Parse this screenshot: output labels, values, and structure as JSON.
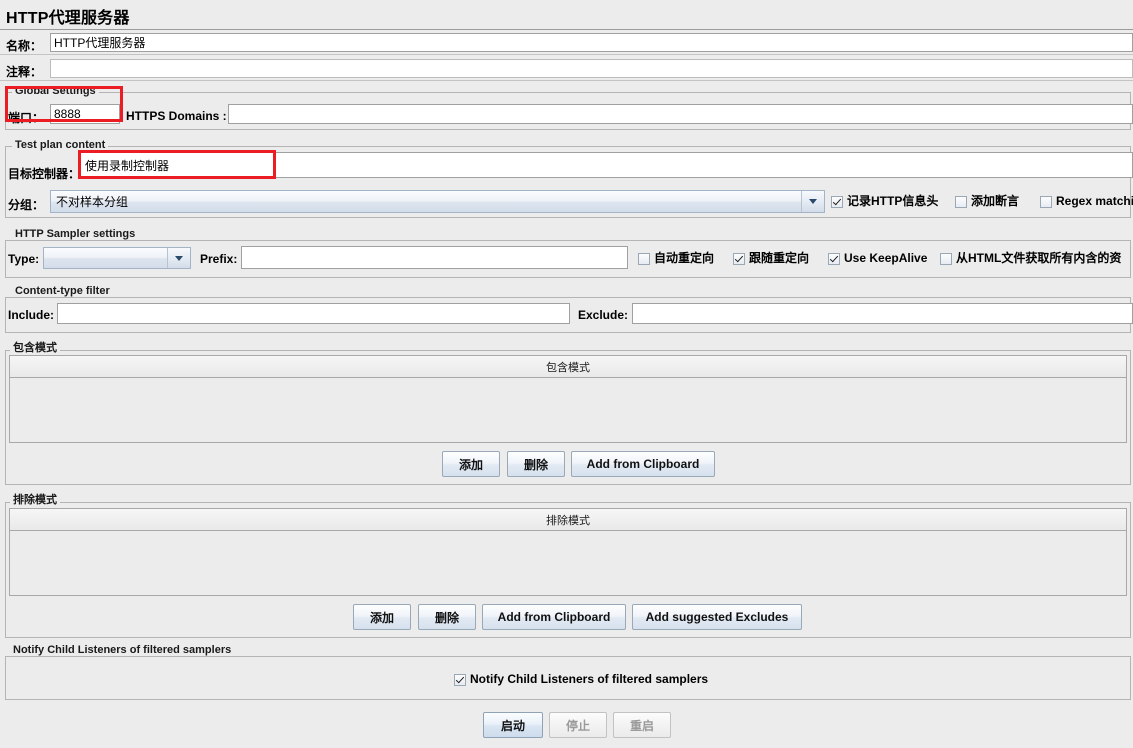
{
  "window": {
    "title": "HTTP代理服务器"
  },
  "fields": {
    "name_label": "名称：",
    "name_value": "HTTP代理服务器",
    "comment_label": "注释：",
    "comment_value": ""
  },
  "global_settings": {
    "panel_title": "Global Settings",
    "port_label": "端口：",
    "port_value": "8888",
    "https_domains_label": "HTTPS Domains :",
    "https_domains_value": ""
  },
  "test_plan_content": {
    "panel_title": "Test plan content",
    "target_controller_label": "目标控制器：",
    "target_controller_value": "使用录制控制器",
    "grouping_label": "分组：",
    "grouping_value": "不对样本分组",
    "checkboxes": [
      {
        "label": "记录HTTP信息头",
        "checked": true
      },
      {
        "label": "添加断言",
        "checked": false
      },
      {
        "label": "Regex matchin",
        "checked": false
      }
    ]
  },
  "http_sampler_settings": {
    "panel_title": "HTTP Sampler settings",
    "type_label": "Type:",
    "type_value": "",
    "prefix_label": "Prefix:",
    "prefix_value": "",
    "checkboxes": [
      {
        "label": "自动重定向",
        "checked": false
      },
      {
        "label": "跟随重定向",
        "checked": true
      },
      {
        "label": "Use KeepAlive",
        "checked": true
      },
      {
        "label": "从HTML文件获取所有内含的资",
        "checked": false
      }
    ]
  },
  "content_type_filter": {
    "panel_title": "Content-type filter",
    "include_label": "Include:",
    "include_value": "",
    "exclude_label": "Exclude:",
    "exclude_value": ""
  },
  "include_patterns": {
    "panel_title": "包含模式",
    "column_header": "包含模式",
    "rows": [],
    "buttons": [
      {
        "label": "添加",
        "name": "add-button"
      },
      {
        "label": "删除",
        "name": "delete-button"
      },
      {
        "label": "Add from Clipboard",
        "name": "add-from-clipboard-button"
      }
    ]
  },
  "exclude_patterns": {
    "panel_title": "排除模式",
    "column_header": "排除模式",
    "rows": [],
    "buttons": [
      {
        "label": "添加",
        "name": "add-button"
      },
      {
        "label": "删除",
        "name": "delete-button"
      },
      {
        "label": "Add from Clipboard",
        "name": "add-from-clipboard-button"
      },
      {
        "label": "Add suggested Excludes",
        "name": "add-suggested-excludes-button"
      }
    ]
  },
  "notify_child_listeners": {
    "panel_title": "Notify Child Listeners of filtered samplers",
    "checkbox_label": "Notify Child Listeners of filtered samplers",
    "checked": true
  },
  "actions": {
    "start_label": "启动",
    "stop_label": "停止",
    "restart_label": "重启",
    "start_enabled": true,
    "stop_enabled": false,
    "restart_enabled": false
  },
  "annotations": {
    "accent_color": "#ec1c24",
    "boxes": [
      {
        "name": "global-settings-highlight"
      },
      {
        "name": "target-controller-highlight"
      }
    ]
  }
}
